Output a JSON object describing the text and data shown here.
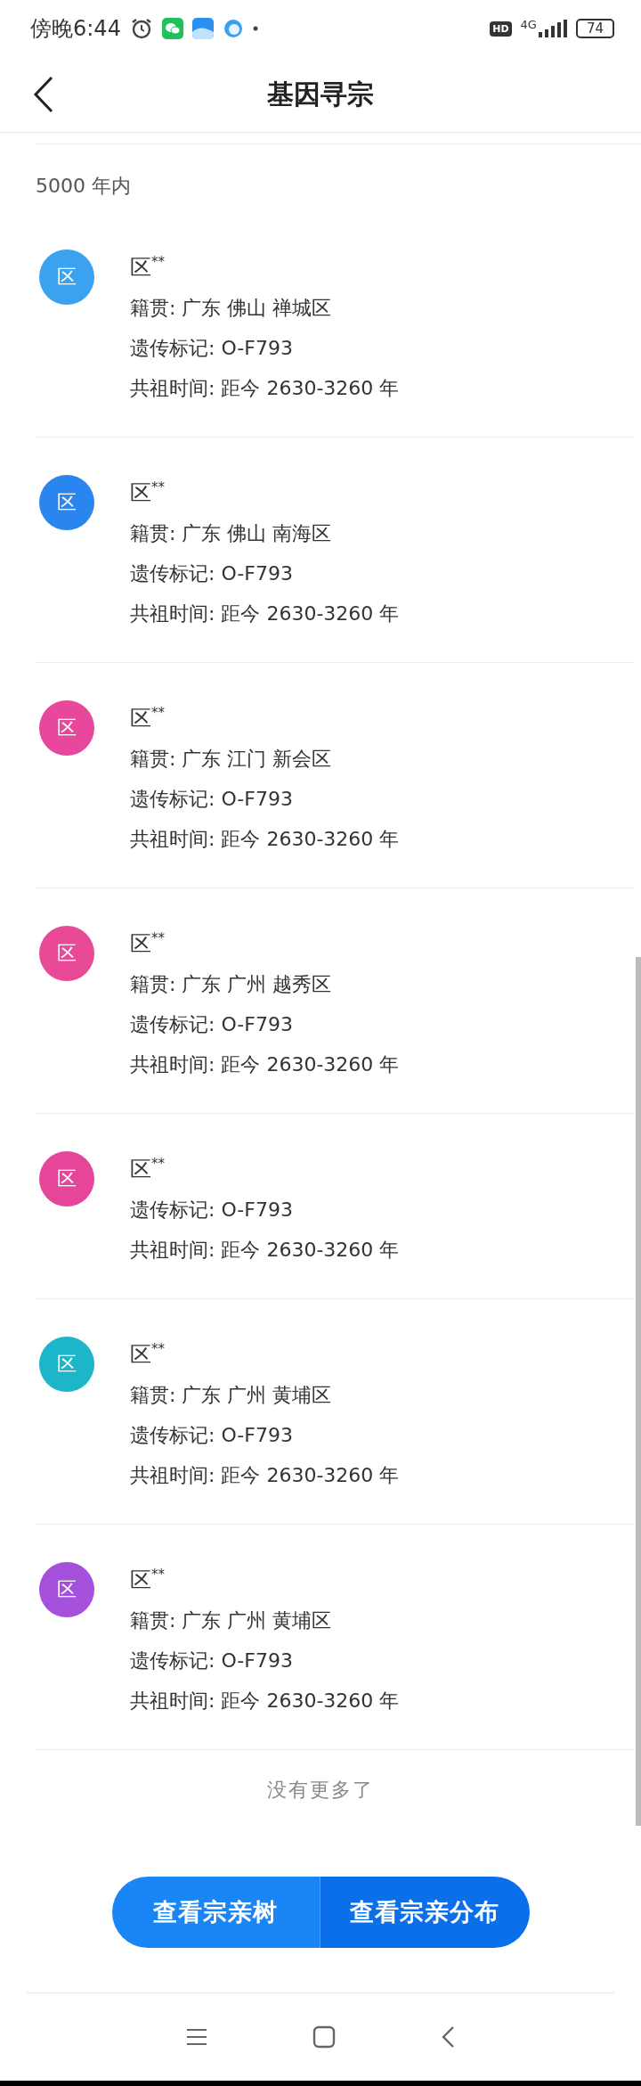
{
  "status_bar": {
    "time": "傍晚6:44",
    "hd": "HD",
    "network": "4G",
    "battery": "74"
  },
  "header": {
    "title": "基因寻宗"
  },
  "section": {
    "title": "5000 年内"
  },
  "items": [
    {
      "avatar": "区",
      "color": "#3aa2ee",
      "name": "区$^{**}$",
      "origin": "籍贯: 广东 佛山 禅城区",
      "marker": "遗传标记: O-F793",
      "time": "共祖时间: 距今 2630-3260 年"
    },
    {
      "avatar": "区",
      "color": "#2b85ee",
      "name": "区$^{**}$",
      "origin": "籍贯: 广东 佛山 南海区",
      "marker": "遗传标记: O-F793",
      "time": "共祖时间: 距今 2630-3260 年"
    },
    {
      "avatar": "区",
      "color": "#e8489b",
      "name": "区$^{**}$",
      "origin": "籍贯: 广东 江门 新会区",
      "marker": "遗传标记: O-F793",
      "time": "共祖时间: 距今 2630-3260 年"
    },
    {
      "avatar": "区",
      "color": "#e84a98",
      "name": "区$^{**}$",
      "origin": "籍贯: 广东 广州 越秀区",
      "marker": "遗传标记: O-F793",
      "time": "共祖时间: 距今 2630-3260 年"
    },
    {
      "avatar": "区",
      "color": "#e6469a",
      "name": "区$^{**}$",
      "marker": "遗传标记: O-F793",
      "time": "共祖时间: 距今 2630-3260 年"
    },
    {
      "avatar": "区",
      "color": "#1cb5c9",
      "name": "区$^{**}$",
      "origin": "籍贯: 广东 广州 黄埔区",
      "marker": "遗传标记: O-F793",
      "time": "共祖时间: 距今 2630-3260 年"
    },
    {
      "avatar": "区",
      "color": "#a651db",
      "name": "区$^{**}$",
      "origin": "籍贯: 广东 广州 黄埔区",
      "marker": "遗传标记: O-F793",
      "time": "共祖时间: 距今 2630-3260 年"
    }
  ],
  "end_note": "没有更多了",
  "buttons": [
    {
      "label": "查看宗亲树",
      "kind": "primary"
    },
    {
      "label": "查看宗亲分布",
      "kind": "secondary"
    }
  ]
}
